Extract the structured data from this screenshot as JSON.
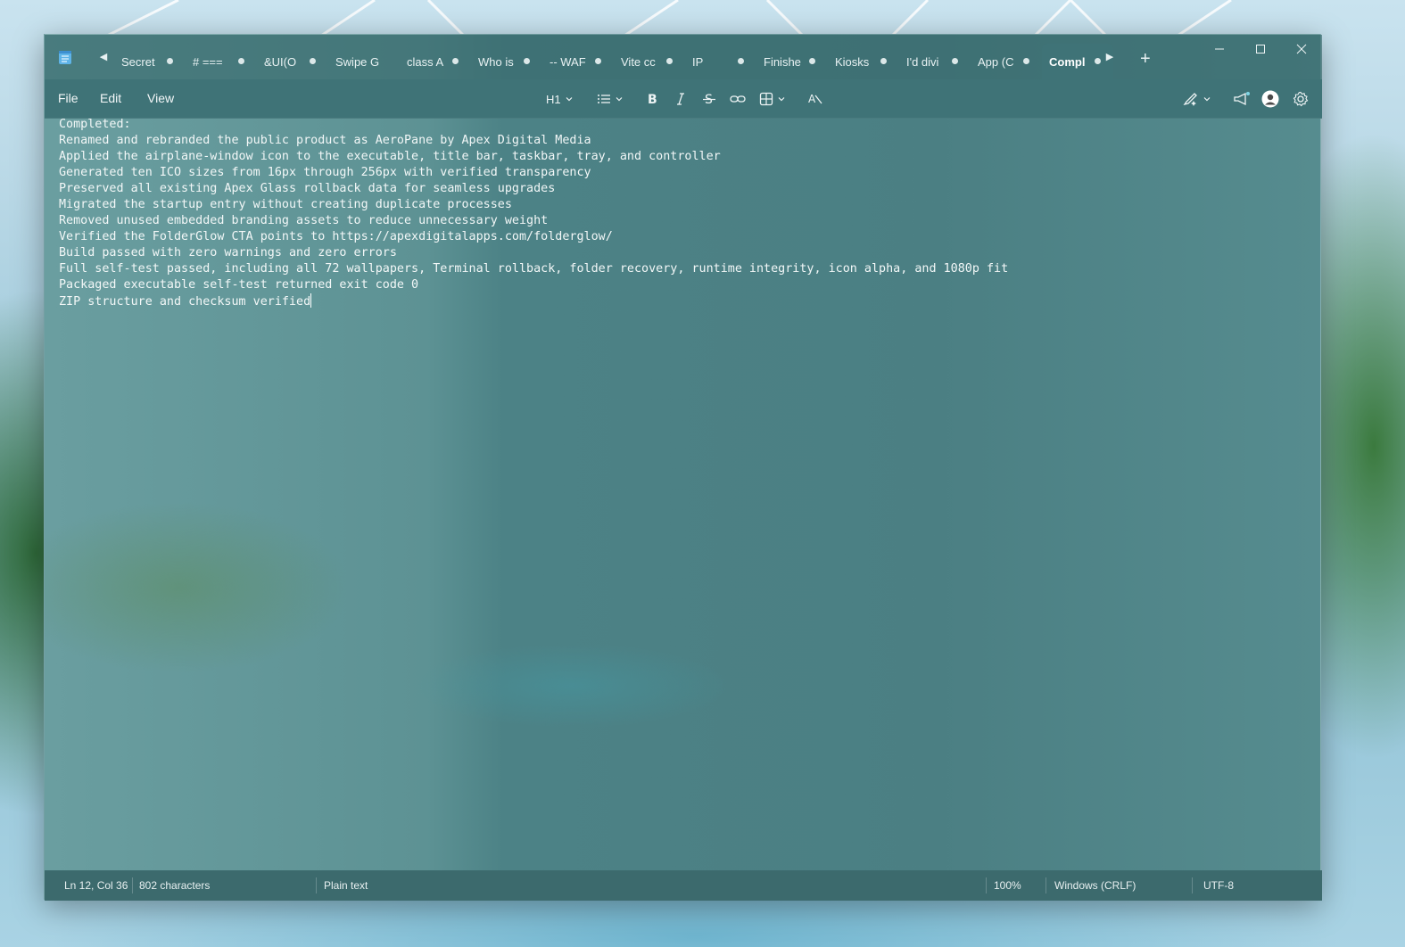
{
  "window": {
    "app_icon": "notepad-icon",
    "tabs": [
      {
        "label": "Secret",
        "modified": true
      },
      {
        "label": "# ===",
        "modified": true
      },
      {
        "label": "&UI(O",
        "modified": true
      },
      {
        "label": "Swipe G Disa",
        "modified": false
      },
      {
        "label": "class A",
        "modified": true
      },
      {
        "label": "Who is",
        "modified": true
      },
      {
        "label": "-- WAF",
        "modified": true
      },
      {
        "label": "Vite cc",
        "modified": true
      },
      {
        "label": "IP",
        "modified": true
      },
      {
        "label": "Finishe",
        "modified": true
      },
      {
        "label": "Kiosks",
        "modified": true
      },
      {
        "label": "I'd divi",
        "modified": true
      },
      {
        "label": "App (C",
        "modified": true
      },
      {
        "label": "Compl",
        "modified": true,
        "active": true
      }
    ],
    "controls": [
      "minimize-icon",
      "maximize-icon",
      "close-icon"
    ]
  },
  "menu": {
    "file": "File",
    "edit": "Edit",
    "view": "View"
  },
  "toolbar": {
    "heading": "H1",
    "tools": [
      "list-icon",
      "bold-icon",
      "italic-icon",
      "strikethrough-icon",
      "link-icon",
      "table-icon",
      "clear-formatting-icon",
      "copilot-pen-icon",
      "announcement-icon",
      "account-icon",
      "settings-icon"
    ]
  },
  "editor": {
    "lines": [
      "Completed:",
      "Renamed and rebranded the public product as AeroPane by Apex Digital Media",
      "Applied the airplane-window icon to the executable, title bar, taskbar, tray, and controller",
      "Generated ten ICO sizes from 16px through 256px with verified transparency",
      "Preserved all existing Apex Glass rollback data for seamless upgrades",
      "Migrated the startup entry without creating duplicate processes",
      "Removed unused embedded branding assets to reduce unnecessary weight",
      "Verified the FolderGlow CTA points to https://apexdigitalapps.com/folderglow/",
      "Build passed with zero warnings and zero errors",
      "Full self-test passed, including all 72 wallpapers, Terminal rollback, folder recovery, runtime integrity, icon alpha, and 1080p fit",
      "Packaged executable self-test returned exit code 0",
      "ZIP structure and checksum verified"
    ]
  },
  "status": {
    "position": "Ln 12, Col 36",
    "characters": "802 characters",
    "format": "Plain text",
    "zoom": "100%",
    "line_ending": "Windows (CRLF)",
    "encoding": "UTF-8"
  }
}
